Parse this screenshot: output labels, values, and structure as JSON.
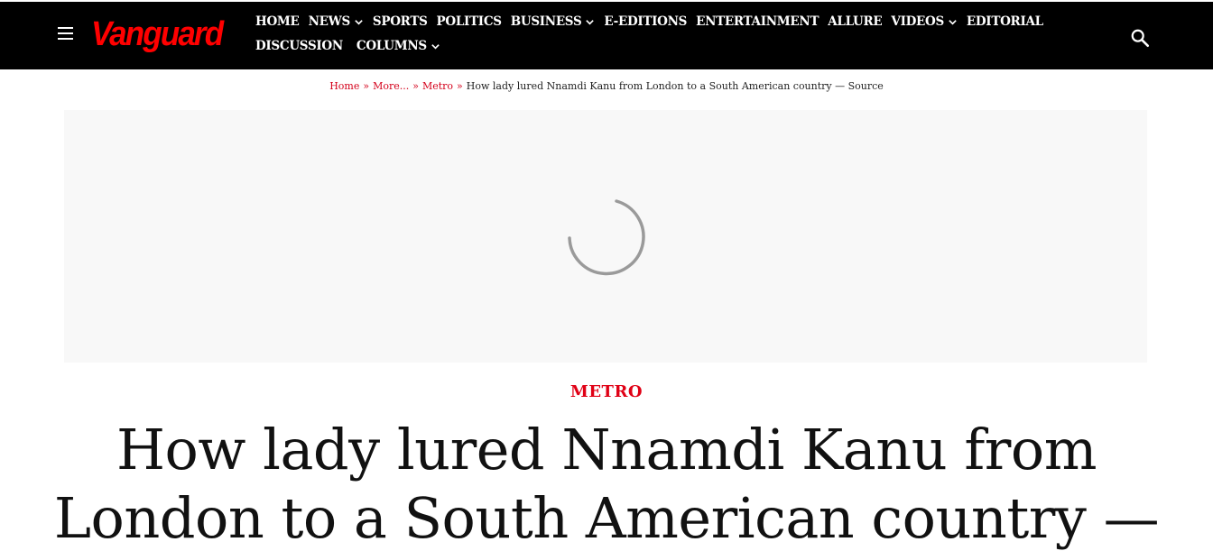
{
  "header": {
    "logo_text": "Vanguard",
    "logo_color": "#ff0000",
    "background": "#000000",
    "nav_items": [
      {
        "label": "HOME",
        "has_dropdown": false
      },
      {
        "label": "NEWS",
        "has_dropdown": true
      },
      {
        "label": "SPORTS",
        "has_dropdown": false
      },
      {
        "label": "POLITICS",
        "has_dropdown": false
      },
      {
        "label": "BUSINESS",
        "has_dropdown": true
      },
      {
        "label": "E-EDITIONS",
        "has_dropdown": false
      },
      {
        "label": "ENTERTAINMENT",
        "has_dropdown": false
      },
      {
        "label": "ALLURE",
        "has_dropdown": false
      },
      {
        "label": "VIDEOS",
        "has_dropdown": true
      },
      {
        "label": "EDITORIAL",
        "has_dropdown": false
      },
      {
        "label": "DISCUSSION",
        "has_dropdown": false
      },
      {
        "label": "COLUMNS",
        "has_dropdown": true
      }
    ],
    "menu_icon": "hamburger-menu-icon",
    "search_icon": "search-icon"
  },
  "breadcrumb": {
    "items": [
      "Home",
      "More...",
      "Metro"
    ],
    "separator": "»",
    "current": "How lady lured Nnamdi Kanu from London to a South American country — Source",
    "link_color": "#d4001a"
  },
  "ad": {
    "background": "#f8f8f8",
    "spinner_icon": "loading-spinner-icon"
  },
  "article": {
    "category": "METRO",
    "category_color": "#e00015",
    "headline": "How lady lured Nnamdi Kanu from London to a South American country —"
  }
}
